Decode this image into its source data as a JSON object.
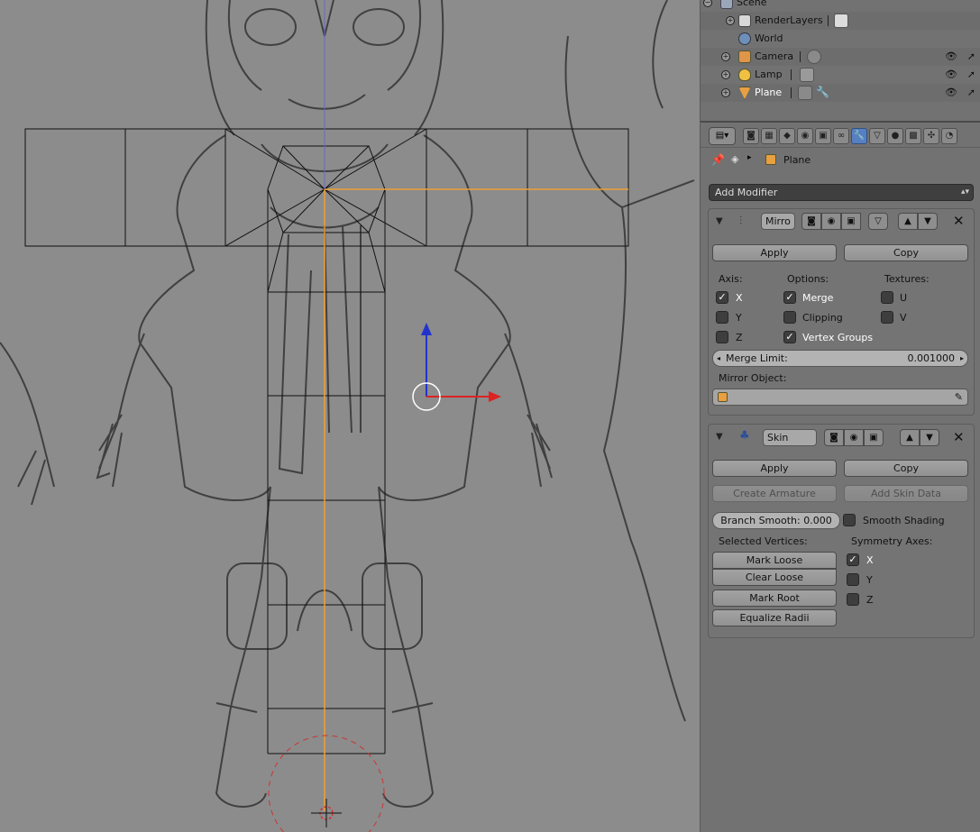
{
  "outliner": {
    "items": [
      {
        "label": "Scene",
        "icon": "scene-icon"
      },
      {
        "label": "RenderLayers",
        "icon": "renderlayers-icon"
      },
      {
        "label": "World",
        "icon": "world-icon"
      },
      {
        "label": "Camera",
        "icon": "camera-icon"
      },
      {
        "label": "Lamp",
        "icon": "lamp-icon"
      },
      {
        "label": "Plane",
        "icon": "mesh-icon"
      }
    ]
  },
  "breadcrumb": {
    "object": "Plane"
  },
  "add_modifier": {
    "label": "Add Modifier"
  },
  "mirror": {
    "name": "Mirro",
    "apply": "Apply",
    "copy": "Copy",
    "axis_label": "Axis:",
    "options_label": "Options:",
    "textures_label": "Textures:",
    "axis": [
      {
        "label": "X",
        "checked": true
      },
      {
        "label": "Y",
        "checked": false
      },
      {
        "label": "Z",
        "checked": false
      }
    ],
    "options": [
      {
        "label": "Merge",
        "checked": true
      },
      {
        "label": "Clipping",
        "checked": false
      },
      {
        "label": "Vertex Groups",
        "checked": true
      }
    ],
    "textures": [
      {
        "label": "U",
        "checked": false
      },
      {
        "label": "V",
        "checked": false
      }
    ],
    "merge_limit_label": "Merge Limit:",
    "merge_limit_value": "0.001000",
    "mirror_object_label": "Mirror Object:"
  },
  "skin": {
    "name": "Skin",
    "apply": "Apply",
    "copy": "Copy",
    "create_armature": "Create Armature",
    "add_skin_data": "Add Skin Data",
    "branch_smooth": "Branch Smooth: 0.000",
    "smooth_shading": "Smooth Shading",
    "selected_vertices_label": "Selected Vertices:",
    "symmetry_axes_label": "Symmetry Axes:",
    "mark_loose": "Mark Loose",
    "clear_loose": "Clear Loose",
    "mark_root": "Mark Root",
    "equalize_radii": "Equalize Radii",
    "symmetry": [
      {
        "label": "X",
        "checked": true
      },
      {
        "label": "Y",
        "checked": false
      },
      {
        "label": "Z",
        "checked": false
      }
    ]
  },
  "colors": {
    "viewport_bg": "#8c8c8c",
    "selected_edge": "#f0a030",
    "gizmo_x": "#dd2222",
    "gizmo_z": "#2233cc",
    "active_tab": "#5680c2"
  }
}
